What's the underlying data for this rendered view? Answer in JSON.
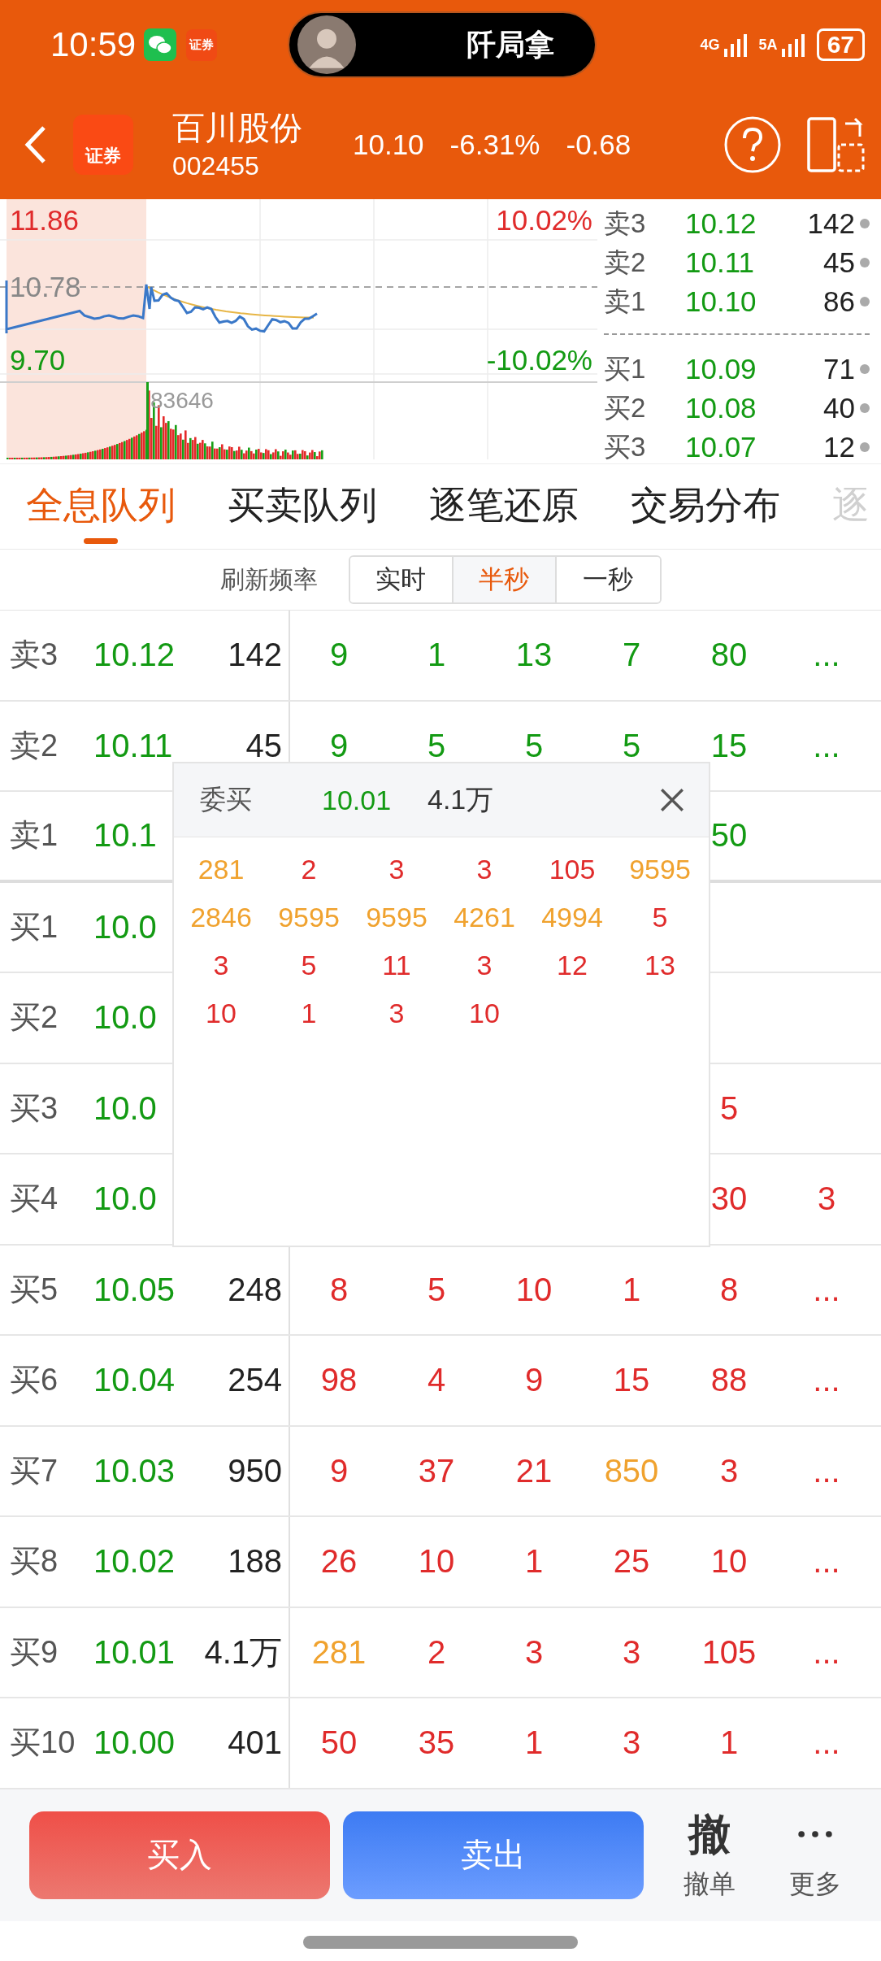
{
  "status_bar": {
    "time": "10:59",
    "app_badge": "证券",
    "island_text": "阡局拿",
    "network_1": "4G",
    "network_2": "5A",
    "battery": "67"
  },
  "header": {
    "logo_text": "证券",
    "name": "百川股份",
    "code": "002455",
    "price": "10.10",
    "change_pct": "-6.31%",
    "change": "-0.68"
  },
  "chart": {
    "high": "11.86",
    "prev_close": "10.78",
    "low": "9.70",
    "high_pct": "10.02%",
    "low_pct": "-10.02%",
    "peak_volume": "83646"
  },
  "order_book": {
    "asks": [
      {
        "label": "卖3",
        "price": "10.12",
        "volume": "142"
      },
      {
        "label": "卖2",
        "price": "10.11",
        "volume": "45"
      },
      {
        "label": "卖1",
        "price": "10.10",
        "volume": "86"
      }
    ],
    "bids": [
      {
        "label": "买1",
        "price": "10.09",
        "volume": "71"
      },
      {
        "label": "买2",
        "price": "10.08",
        "volume": "40"
      },
      {
        "label": "买3",
        "price": "10.07",
        "volume": "12"
      }
    ]
  },
  "tabs": [
    {
      "label": "全息队列",
      "selected": true,
      "faded": false
    },
    {
      "label": "买卖队列",
      "selected": false,
      "faded": false
    },
    {
      "label": "逐笔还原",
      "selected": false,
      "faded": false
    },
    {
      "label": "交易分布",
      "selected": false,
      "faded": false
    },
    {
      "label": "逐",
      "selected": false,
      "faded": true
    }
  ],
  "refresh": {
    "label": "刷新频率",
    "options": [
      {
        "label": "实时",
        "selected": false
      },
      {
        "label": "半秒",
        "selected": true
      },
      {
        "label": "一秒",
        "selected": false
      }
    ]
  },
  "queue_rows": [
    {
      "label": "卖3",
      "price": "10.12",
      "volume": "142",
      "separator": false,
      "cells": [
        {
          "text": "9",
          "color": "#139a13"
        },
        {
          "text": "1",
          "color": "#139a13"
        },
        {
          "text": "13",
          "color": "#139a13"
        },
        {
          "text": "7",
          "color": "#139a13"
        },
        {
          "text": "80",
          "color": "#139a13"
        },
        {
          "text": "...",
          "color": "#139a13"
        }
      ]
    },
    {
      "label": "卖2",
      "price": "10.11",
      "volume": "45",
      "separator": false,
      "cells": [
        {
          "text": "9",
          "color": "#139a13"
        },
        {
          "text": "5",
          "color": "#139a13"
        },
        {
          "text": "5",
          "color": "#139a13"
        },
        {
          "text": "5",
          "color": "#139a13"
        },
        {
          "text": "15",
          "color": "#139a13"
        },
        {
          "text": "...",
          "color": "#139a13"
        }
      ]
    },
    {
      "label": "卖1",
      "price": "10.1",
      "separator": true,
      "cells": [
        null,
        null,
        null,
        null,
        {
          "text": "50",
          "color": "#139a13"
        },
        null
      ]
    },
    {
      "label": "买1",
      "price": "10.0",
      "separator": false,
      "cells": [
        null,
        null,
        null,
        null,
        null,
        null
      ]
    },
    {
      "label": "买2",
      "price": "10.0",
      "separator": false,
      "cells": [
        null,
        null,
        null,
        null,
        null,
        null
      ]
    },
    {
      "label": "买3",
      "price": "10.0",
      "separator": false,
      "cells": [
        null,
        null,
        null,
        null,
        {
          "text": "5",
          "color": "#e02b2b"
        },
        null
      ]
    },
    {
      "label": "买4",
      "price": "10.0",
      "separator": false,
      "cells": [
        null,
        null,
        null,
        null,
        {
          "text": "30",
          "color": "#e02b2b"
        },
        {
          "text": "3",
          "color": "#e02b2b"
        }
      ]
    },
    {
      "label": "买5",
      "price": "10.05",
      "volume": "248",
      "separator": false,
      "cells": [
        {
          "text": "8",
          "color": "#e02b2b"
        },
        {
          "text": "5",
          "color": "#e02b2b"
        },
        {
          "text": "10",
          "color": "#e02b2b"
        },
        {
          "text": "1",
          "color": "#e02b2b"
        },
        {
          "text": "8",
          "color": "#e02b2b"
        },
        {
          "text": "...",
          "color": "#e02b2b"
        }
      ]
    },
    {
      "label": "买6",
      "price": "10.04",
      "volume": "254",
      "separator": false,
      "cells": [
        {
          "text": "98",
          "color": "#e02b2b"
        },
        {
          "text": "4",
          "color": "#e02b2b"
        },
        {
          "text": "9",
          "color": "#e02b2b"
        },
        {
          "text": "15",
          "color": "#e02b2b"
        },
        {
          "text": "88",
          "color": "#e02b2b"
        },
        {
          "text": "...",
          "color": "#e02b2b"
        }
      ]
    },
    {
      "label": "买7",
      "price": "10.03",
      "volume": "950",
      "separator": false,
      "cells": [
        {
          "text": "9",
          "color": "#e02b2b"
        },
        {
          "text": "37",
          "color": "#e02b2b"
        },
        {
          "text": "21",
          "color": "#e02b2b"
        },
        {
          "text": "850",
          "color": "#f0a22e"
        },
        {
          "text": "3",
          "color": "#e02b2b"
        },
        {
          "text": "...",
          "color": "#e02b2b"
        }
      ]
    },
    {
      "label": "买8",
      "price": "10.02",
      "volume": "188",
      "separator": false,
      "cells": [
        {
          "text": "26",
          "color": "#e02b2b"
        },
        {
          "text": "10",
          "color": "#e02b2b"
        },
        {
          "text": "1",
          "color": "#e02b2b"
        },
        {
          "text": "25",
          "color": "#e02b2b"
        },
        {
          "text": "10",
          "color": "#e02b2b"
        },
        {
          "text": "...",
          "color": "#e02b2b"
        }
      ]
    },
    {
      "label": "买9",
      "price": "10.01",
      "volume": "4.1万",
      "separator": false,
      "cells": [
        {
          "text": "281",
          "color": "#f0a22e"
        },
        {
          "text": "2",
          "color": "#e02b2b"
        },
        {
          "text": "3",
          "color": "#e02b2b"
        },
        {
          "text": "3",
          "color": "#e02b2b"
        },
        {
          "text": "105",
          "color": "#e02b2b"
        },
        {
          "text": "...",
          "color": "#e02b2b"
        }
      ]
    },
    {
      "label": "买10",
      "price": "10.00",
      "volume": "401",
      "separator": false,
      "cells": [
        {
          "text": "50",
          "color": "#e02b2b"
        },
        {
          "text": "35",
          "color": "#e02b2b"
        },
        {
          "text": "1",
          "color": "#e02b2b"
        },
        {
          "text": "3",
          "color": "#e02b2b"
        },
        {
          "text": "1",
          "color": "#e02b2b"
        },
        {
          "text": "...",
          "color": "#e02b2b"
        }
      ]
    }
  ],
  "popup": {
    "side": "委买",
    "price": "10.01",
    "volume": "4.1万",
    "orders": [
      {
        "text": "281",
        "color": "#f0a22e"
      },
      {
        "text": "2",
        "color": "#e02b2b"
      },
      {
        "text": "3",
        "color": "#e02b2b"
      },
      {
        "text": "3",
        "color": "#e02b2b"
      },
      {
        "text": "105",
        "color": "#e02b2b"
      },
      {
        "text": "9595",
        "color": "#f0a22e"
      },
      {
        "text": "2846",
        "color": "#f0a22e"
      },
      {
        "text": "9595",
        "color": "#f0a22e"
      },
      {
        "text": "9595",
        "color": "#f0a22e"
      },
      {
        "text": "4261",
        "color": "#f0a22e"
      },
      {
        "text": "4994",
        "color": "#f0a22e"
      },
      {
        "text": "5",
        "color": "#e02b2b"
      },
      {
        "text": "3",
        "color": "#e02b2b"
      },
      {
        "text": "5",
        "color": "#e02b2b"
      },
      {
        "text": "11",
        "color": "#e02b2b"
      },
      {
        "text": "3",
        "color": "#e02b2b"
      },
      {
        "text": "12",
        "color": "#e02b2b"
      },
      {
        "text": "13",
        "color": "#e02b2b"
      },
      {
        "text": "10",
        "color": "#e02b2b"
      },
      {
        "text": "1",
        "color": "#e02b2b"
      },
      {
        "text": "3",
        "color": "#e02b2b"
      },
      {
        "text": "10",
        "color": "#e02b2b"
      }
    ]
  },
  "bottom_bar": {
    "buy": "买入",
    "sell": "卖出",
    "cancel_glyph": "撤",
    "cancel_label": "撤单",
    "more_label": "更多"
  }
}
